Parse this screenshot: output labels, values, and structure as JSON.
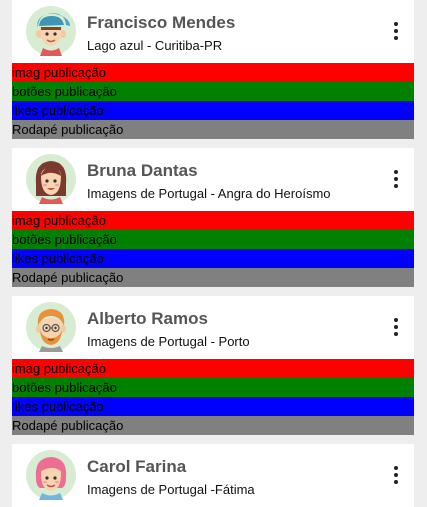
{
  "colors": {
    "image_bar": "#ff0000",
    "buttons_bar": "#008000",
    "likes_bar": "#0000ff",
    "footer_bar": "#808080"
  },
  "posts": [
    {
      "name": "Francisco Mendes",
      "location": "Lago azul - Curitiba-PR",
      "avatar": "male-avatar-cap-icon",
      "image_label": "imag publicação",
      "buttons_label": "botões publicação",
      "likes_label": "likes publicação",
      "footer_label": "Rodapé publicação"
    },
    {
      "name": "Bruna Dantas",
      "location": "Imagens de Portugal - Angra do Heroísmo",
      "avatar": "female-avatar-icon",
      "image_label": "imag publicação",
      "buttons_label": "botões publicação",
      "likes_label": "likes publicação",
      "footer_label": "Rodapé publicação"
    },
    {
      "name": "Alberto Ramos",
      "location": "Imagens de Portugal - Porto",
      "avatar": "male-avatar-beard-icon",
      "image_label": "imag publicação",
      "buttons_label": "botões publicação",
      "likes_label": "likes publicação",
      "footer_label": "Rodapé publicação"
    },
    {
      "name": "Carol Farina",
      "location": "Imagens de Portugal -Fátima",
      "avatar": "female-avatar-pink-hair-icon"
    }
  ]
}
